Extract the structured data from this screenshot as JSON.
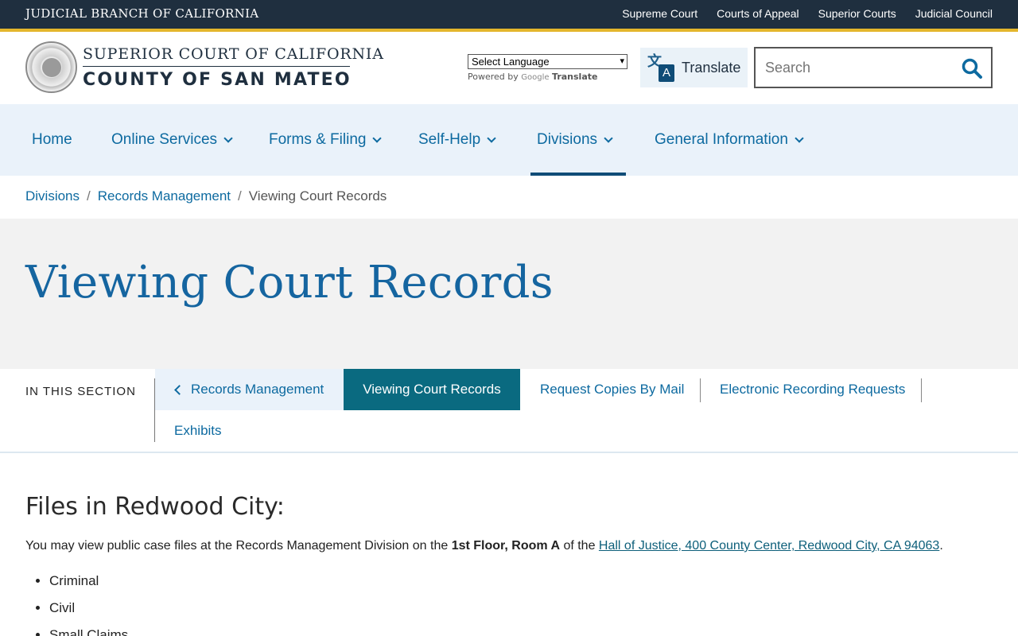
{
  "topbar": {
    "title": "JUDICIAL BRANCH OF CALIFORNIA",
    "links": [
      "Supreme Court",
      "Courts of Appeal",
      "Superior Courts",
      "Judicial Council"
    ]
  },
  "header": {
    "logo_line1": "SUPERIOR COURT OF CALIFORNIA",
    "logo_line2": "COUNTY OF SAN MATEO",
    "language_select": "Select Language",
    "powered_by": "Powered by",
    "google": "Google",
    "translate_word": "Translate",
    "translate_button": "Translate",
    "search_placeholder": "Search"
  },
  "nav": {
    "items": [
      {
        "label": "Home"
      },
      {
        "label": "Online Services"
      },
      {
        "label": "Forms & Filing"
      },
      {
        "label": "Self-Help"
      },
      {
        "label": "Divisions"
      },
      {
        "label": "General Information"
      }
    ],
    "active": "Divisions"
  },
  "breadcrumb": {
    "items": [
      "Divisions",
      "Records Management",
      "Viewing Court Records"
    ],
    "separator": "/"
  },
  "page": {
    "title": "Viewing Court Records"
  },
  "section_nav": {
    "label": "IN THIS SECTION",
    "back": "Records Management",
    "items": [
      "Viewing Court Records",
      "Request Copies By Mail",
      "Electronic Recording Requests",
      "Exhibits"
    ],
    "active": "Viewing Court Records"
  },
  "content": {
    "heading": "Files in Redwood City:",
    "para_prefix": "You may view public case files at the Records Management Division on the ",
    "para_bold": "1st Floor, Room A",
    "para_mid": " of the ",
    "para_link": "Hall of Justice, 400 County Center, Redwood City, CA 94063",
    "para_suffix": ".",
    "list": [
      "Criminal",
      "Civil",
      "Small Claims"
    ]
  },
  "colors": {
    "topbar_bg": "#1f2f3f",
    "accent_gold": "#e4b62c",
    "link_blue": "#0d6aa0",
    "active_teal": "#0a6a80"
  }
}
